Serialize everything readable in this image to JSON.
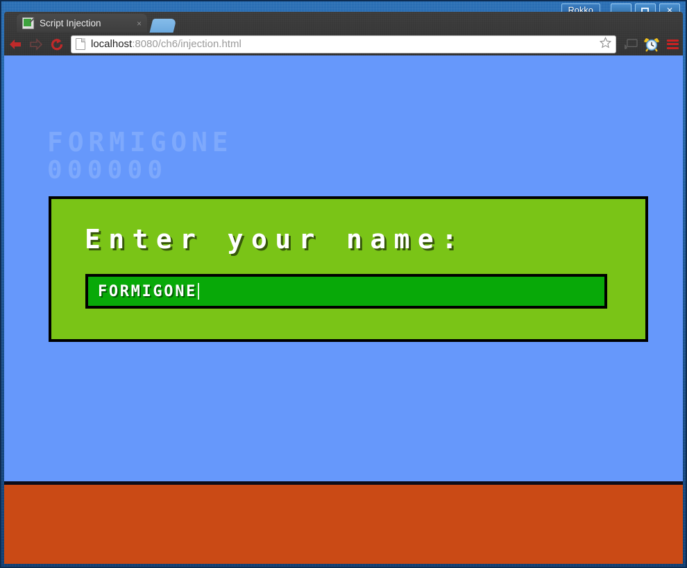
{
  "window": {
    "user_label": "Rokko",
    "buttons": {
      "minimize": "minimize",
      "maximize": "maximize",
      "close": "close"
    }
  },
  "browser": {
    "tab": {
      "title": "Script Injection",
      "close_label": "×",
      "favicon": "document-green-icon"
    },
    "new_tab_label": "",
    "nav": {
      "back": "back-arrow-icon",
      "forward": "forward-arrow-icon",
      "reload": "reload-icon"
    },
    "url": {
      "host": "localhost",
      "path": ":8080/ch6/injection.html",
      "full": "localhost:8080/ch6/injection.html",
      "page_icon": "page-icon",
      "bookmark": "star-icon"
    },
    "toolbar_icons": {
      "cast": "cast-icon",
      "alarm": "alarm-clock-icon",
      "menu": "hamburger-menu-icon"
    }
  },
  "page": {
    "hud": {
      "player_name": "FORMIGONE",
      "score": "000000"
    },
    "dialog": {
      "prompt": "Enter your name:",
      "input_value": "FORMIGONE",
      "input_placeholder": ""
    },
    "colors": {
      "sky": "#6698fb",
      "ground": "#ca4a15",
      "panel": "#7ac417",
      "input": "#08a908",
      "outline": "#000000",
      "hud_text": "#7ea9fc"
    }
  }
}
